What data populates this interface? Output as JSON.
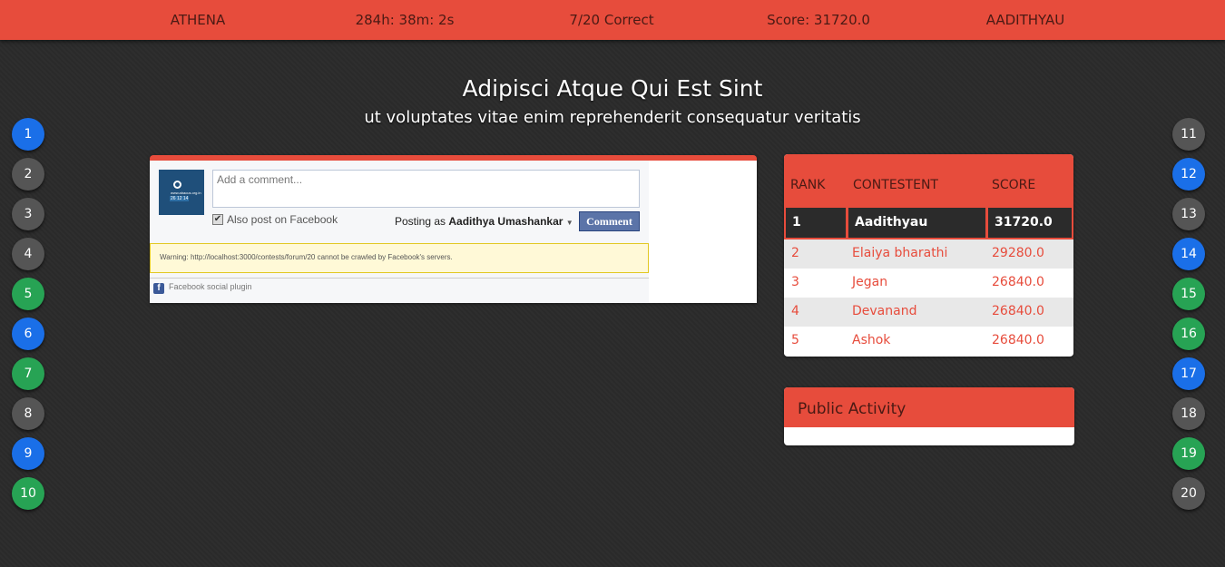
{
  "topbar": {
    "contest": "ATHENA",
    "timer": "284h: 38m: 2s",
    "correct": "7/20 Correct",
    "score": "Score: 31720.0",
    "user": "AADITHYAU"
  },
  "question": {
    "title": "Adipisci Atque Qui Est Sint",
    "subtitle": "ut voluptates vitae enim reprehenderit consequatur veritatis"
  },
  "questions_left": [
    {
      "num": "1",
      "status": "blue"
    },
    {
      "num": "2",
      "status": "grey"
    },
    {
      "num": "3",
      "status": "grey"
    },
    {
      "num": "4",
      "status": "grey"
    },
    {
      "num": "5",
      "status": "green"
    },
    {
      "num": "6",
      "status": "blue"
    },
    {
      "num": "7",
      "status": "green"
    },
    {
      "num": "8",
      "status": "grey"
    },
    {
      "num": "9",
      "status": "blue"
    },
    {
      "num": "10",
      "status": "green"
    }
  ],
  "questions_right": [
    {
      "num": "11",
      "status": "grey"
    },
    {
      "num": "12",
      "status": "blue"
    },
    {
      "num": "13",
      "status": "grey"
    },
    {
      "num": "14",
      "status": "blue"
    },
    {
      "num": "15",
      "status": "green"
    },
    {
      "num": "16",
      "status": "green"
    },
    {
      "num": "17",
      "status": "blue"
    },
    {
      "num": "18",
      "status": "grey"
    },
    {
      "num": "19",
      "status": "green"
    },
    {
      "num": "20",
      "status": "grey"
    }
  ],
  "status_colors": {
    "blue": "#1a6fe8",
    "grey": "#555555",
    "green": "#27a354"
  },
  "accent_color": "#e74c3c",
  "comments": {
    "avatar_logo_text": "www.abacus.org.in",
    "avatar_date": "26 12 14",
    "placeholder": "Add a comment...",
    "also_post_label": "Also post on Facebook",
    "also_post_checked": true,
    "posting_as_prefix": "Posting as",
    "posting_as_name": "Aadithya Umashankar",
    "comment_button": "Comment",
    "warning": "Warning: http://localhost:3000/contests/forum/20 cannot be crawled by Facebook's servers.",
    "plugin_label": "Facebook social plugin"
  },
  "leaderboard": {
    "headers": {
      "rank": "RANK",
      "contestant": "CONTESTENT",
      "score": "SCORE"
    },
    "rows": [
      {
        "rank": "1",
        "name": "Aadithyau",
        "score": "31720.0"
      },
      {
        "rank": "2",
        "name": "Elaiya bharathi",
        "score": "29280.0"
      },
      {
        "rank": "3",
        "name": "Jegan",
        "score": "26840.0"
      },
      {
        "rank": "4",
        "name": "Devanand",
        "score": "26840.0"
      },
      {
        "rank": "5",
        "name": "Ashok",
        "score": "26840.0"
      }
    ]
  },
  "activity": {
    "title": "Public Activity"
  }
}
